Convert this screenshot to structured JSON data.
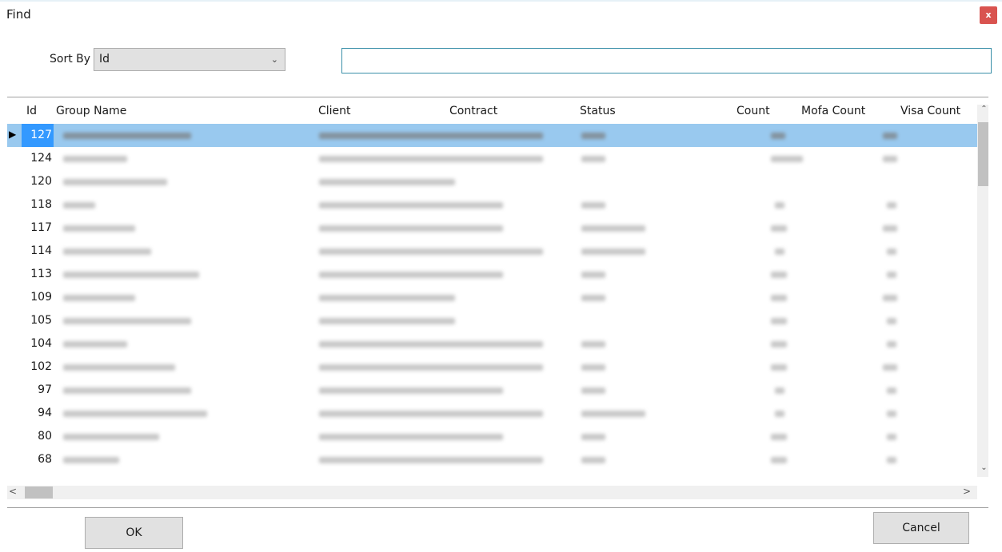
{
  "window": {
    "title": "Find",
    "close_label": "x"
  },
  "sort": {
    "label": "Sort By",
    "selected": "Id"
  },
  "search": {
    "value": "",
    "placeholder": ""
  },
  "columns": [
    "Id",
    "Group Name",
    "Client",
    "Contract",
    "Status",
    "Count",
    "Mofa Count",
    "Visa Count"
  ],
  "rows": [
    {
      "id": "127"
    },
    {
      "id": "124"
    },
    {
      "id": "120"
    },
    {
      "id": "118"
    },
    {
      "id": "117"
    },
    {
      "id": "114"
    },
    {
      "id": "113"
    },
    {
      "id": "109"
    },
    {
      "id": "105"
    },
    {
      "id": "104"
    },
    {
      "id": "102"
    },
    {
      "id": "97"
    },
    {
      "id": "94"
    },
    {
      "id": "80"
    },
    {
      "id": "68"
    }
  ],
  "selected_row_index": 0,
  "buttons": {
    "ok": "OK",
    "cancel": "Cancel"
  }
}
